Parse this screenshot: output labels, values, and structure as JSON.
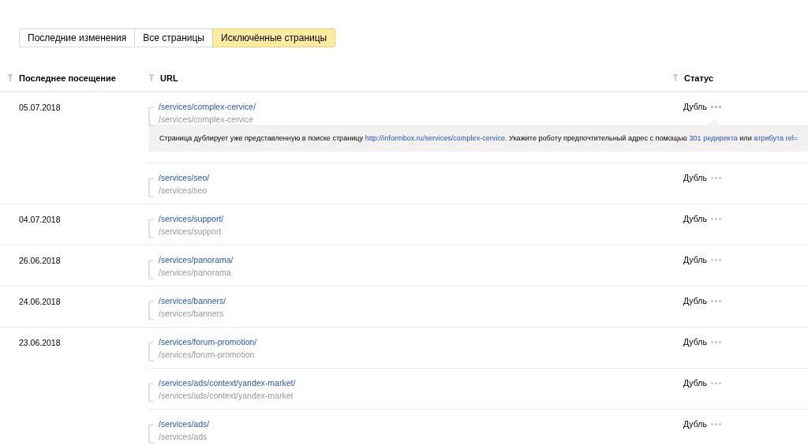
{
  "tabs": [
    {
      "label": "Последние изменения",
      "selected": false
    },
    {
      "label": "Все страницы",
      "selected": false
    },
    {
      "label": "Исключённые страницы",
      "selected": true
    }
  ],
  "table": {
    "columns": [
      "Последнее посещение",
      "URL",
      "Статус"
    ],
    "groups": [
      {
        "date": "05.07.2018",
        "entries": [
          {
            "url": "/services/complex-cervice/",
            "path": "/services/complex-cervice",
            "status": "Дубль",
            "expanded": true,
            "detail": [
              {
                "kind": "text",
                "text": "Страница дублирует уже представленную в поиске страницу "
              },
              {
                "kind": "link",
                "text": "http://informbox.ru/services/complex-cervice"
              },
              {
                "kind": "text",
                "text": ". Укажите роботу предпочтительный адрес с помощью "
              },
              {
                "kind": "link",
                "text": "301 редиректа"
              },
              {
                "kind": "text",
                "text": " или "
              },
              {
                "kind": "link",
                "text": "атрибута rel="
              }
            ]
          },
          {
            "url": "/services/seo/",
            "path": "/services/seo",
            "status": "Дубль",
            "expanded": false
          }
        ]
      },
      {
        "date": "04.07.2018",
        "entries": [
          {
            "url": "/services/support/",
            "path": "/services/support",
            "status": "Дубль",
            "expanded": false
          }
        ]
      },
      {
        "date": "26.06.2018",
        "entries": [
          {
            "url": "/services/panorama/",
            "path": "/services/panorama",
            "status": "Дубль",
            "expanded": false
          }
        ]
      },
      {
        "date": "24.06.2018",
        "entries": [
          {
            "url": "/services/banners/",
            "path": "/services/banners",
            "status": "Дубль",
            "expanded": false
          }
        ]
      },
      {
        "date": "23.06.2018",
        "entries": [
          {
            "url": "/services/forum-promotion/",
            "path": "/services/forum-promotion",
            "status": "Дубль",
            "expanded": false
          },
          {
            "url": "/services/ads/context/yandex-market/",
            "path": "/services/ads/context/yandex-market",
            "status": "Дубль",
            "expanded": false
          },
          {
            "url": "/services/ads/",
            "path": "/services/ads",
            "status": "Дубль",
            "expanded": false
          }
        ]
      }
    ]
  }
}
